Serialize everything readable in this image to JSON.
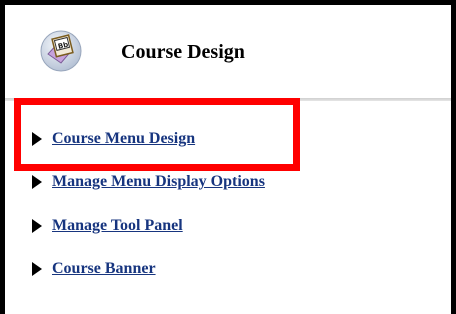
{
  "header": {
    "icon": "course-design-icon",
    "title": "Course Design"
  },
  "menu": {
    "items": [
      {
        "label": "Course Menu Design",
        "icon": "triangle-right-icon"
      },
      {
        "label": "Manage Menu Display Options",
        "icon": "triangle-right-icon"
      },
      {
        "label": "Manage Tool Panel",
        "icon": "triangle-right-icon"
      },
      {
        "label": "Course Banner",
        "icon": "triangle-right-icon"
      }
    ]
  },
  "colors": {
    "link": "#17357f",
    "highlight": "#ff0000",
    "frame": "#000000"
  }
}
